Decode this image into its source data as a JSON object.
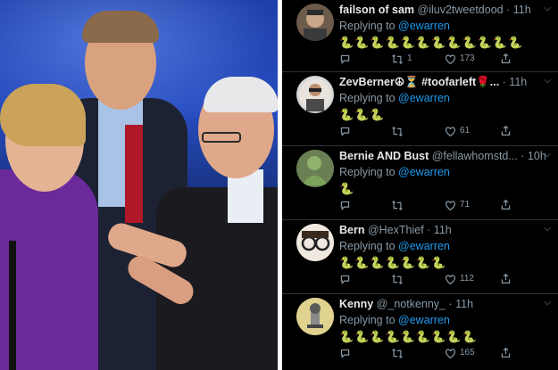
{
  "colors": {
    "feed_background": "#000000",
    "name_text": "#e7e9ea",
    "secondary_text": "#8899a6",
    "mention": "#1d9bf0",
    "divider": "#2f3336",
    "snake_emoji": "#b9c23a"
  },
  "photo": {
    "description_icon": "debate-stage-photo"
  },
  "tweets": [
    {
      "name": "failson of sam",
      "handle": "@iluv2tweetdood",
      "time": "· 11h",
      "reply_prefix": "Replying to",
      "mention": "@ewarren",
      "snakes": "🐍🐍🐍🐍🐍🐍🐍🐍🐍🐍🐍🐍",
      "replies": "",
      "retweets": "1",
      "likes": "173"
    },
    {
      "name": "ZevBerner☮⏳ #toofarleft🌹...",
      "handle": "",
      "time": "· 11h",
      "reply_prefix": "Replying to",
      "mention": "@ewarren",
      "snakes": "🐍🐍🐍",
      "replies": "",
      "retweets": "",
      "likes": "61"
    },
    {
      "name": "Bernie AND Bust",
      "handle": "@fellawhomstd...",
      "time": "· 10h",
      "reply_prefix": "Replying to",
      "mention": "@ewarren",
      "snakes": "🐍",
      "replies": "",
      "retweets": "",
      "likes": "71"
    },
    {
      "name": "Bern",
      "handle": "@HexThief",
      "time": "· 11h",
      "reply_prefix": "Replying to",
      "mention": "@ewarren",
      "snakes": "🐍🐍🐍🐍🐍🐍🐍",
      "replies": "",
      "retweets": "",
      "likes": "112"
    },
    {
      "name": "Kenny",
      "handle": "@_notkenny_",
      "time": "· 11h",
      "reply_prefix": "Replying to",
      "mention": "@ewarren",
      "snakes": "🐍🐍🐍🐍🐍🐍🐍🐍🐍",
      "replies": "",
      "retweets": "",
      "likes": "165"
    }
  ]
}
